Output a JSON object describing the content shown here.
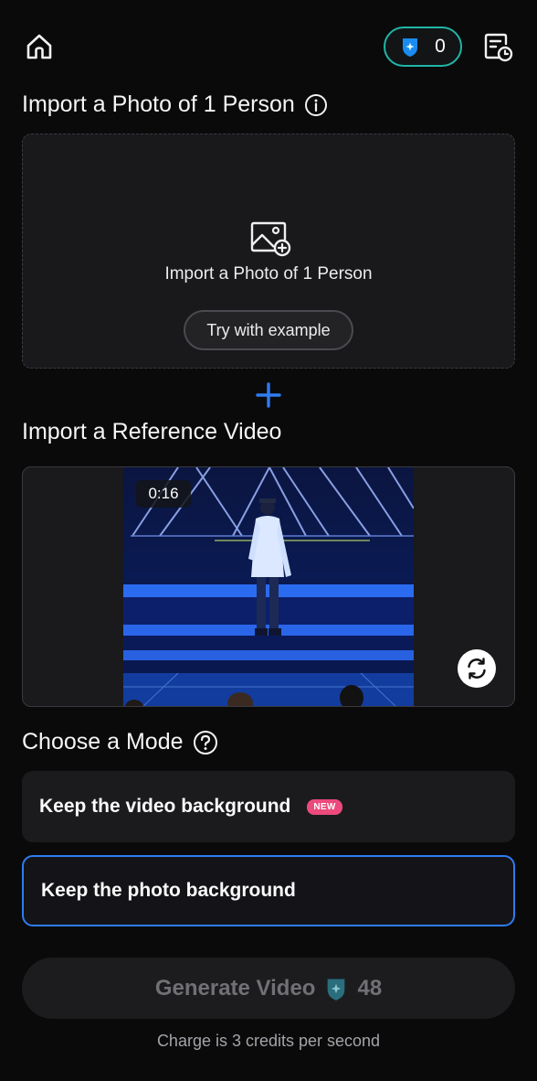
{
  "header": {
    "credits_count": "0"
  },
  "photo_section": {
    "title": "Import a Photo of 1 Person",
    "upload_label": "Import a Photo of 1 Person",
    "try_example_label": "Try with example"
  },
  "video_section": {
    "title": "Import a Reference Video",
    "duration": "0:16"
  },
  "mode_section": {
    "title": "Choose a Mode",
    "options": [
      {
        "label": "Keep the video background",
        "badge": "NEW",
        "selected": false
      },
      {
        "label": "Keep the photo background",
        "selected": true
      }
    ]
  },
  "generate": {
    "label": "Generate Video",
    "cost": "48",
    "charge_note": "Charge is 3 credits per second"
  },
  "colors": {
    "accent_blue": "#2f7cf0",
    "credit_teal": "#1fb6a6",
    "new_badge": "#ec4a7c"
  }
}
